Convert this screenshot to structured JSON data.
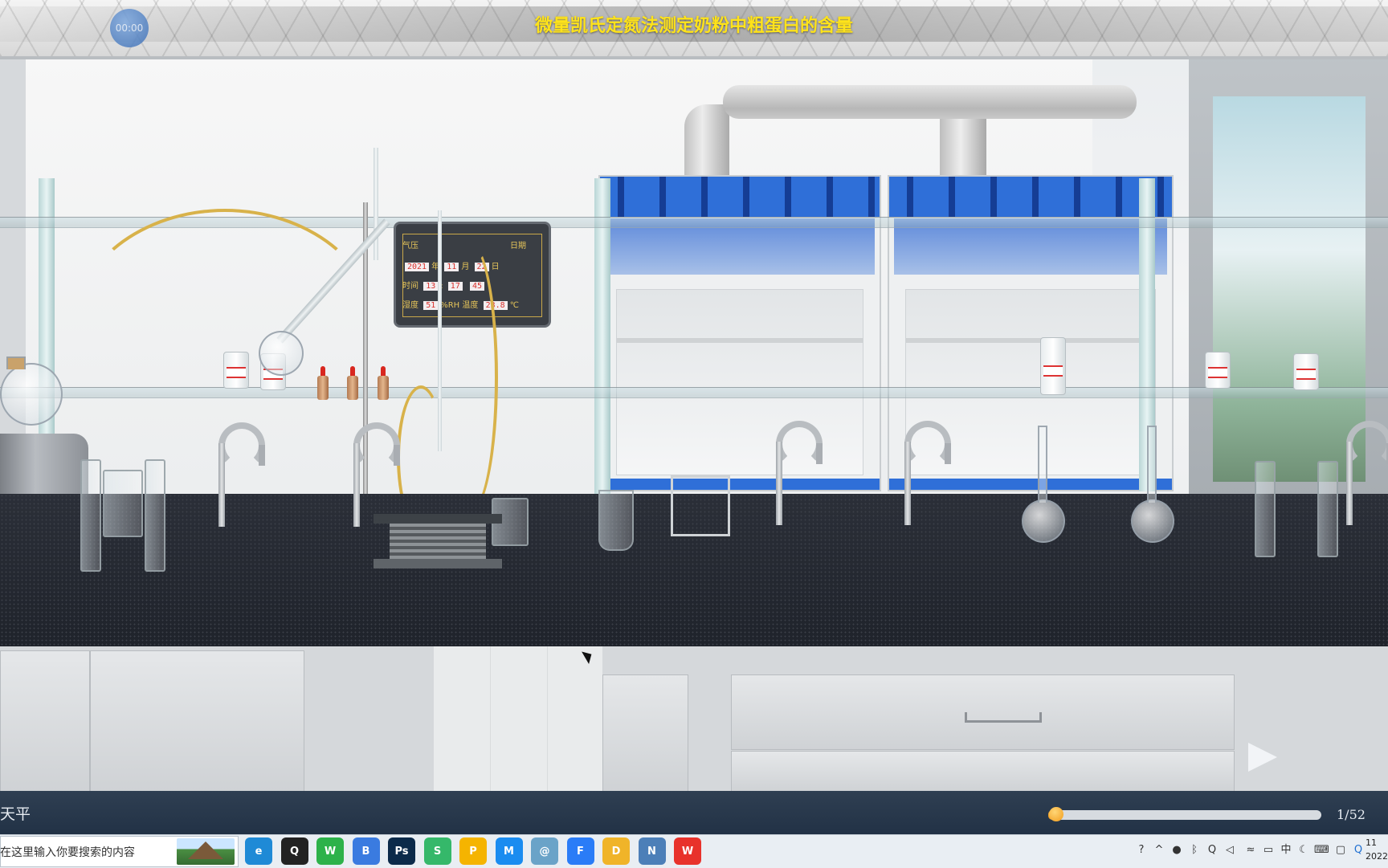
{
  "app": {
    "title": "微量凯氏定氮法测定奶粉中粗蛋白的含量",
    "timer": "00:00"
  },
  "monitor": {
    "pressure_label": "气压",
    "date_label": "日期",
    "year_value": "2021",
    "year_unit": "年",
    "month_value": "11",
    "month_unit": "月",
    "day_value": "22",
    "day_unit": "日",
    "time_label": "时间",
    "hour_value": "13",
    "time_sep": ":",
    "minute_value": "17",
    "second_value": "45",
    "humidity_label": "湿度",
    "humidity_value": "51",
    "humidity_unit": "%RH",
    "temp_label": "温度",
    "temp_value": "23.8",
    "temp_unit": "℃"
  },
  "controls": {
    "step_label": "天平",
    "page_count": "1/52",
    "progress": 0.03,
    "colors": {
      "bar": "#223246",
      "fill": "#f2a42a"
    }
  },
  "taskbar": {
    "search_text": "在这里输入你要搜索的内容",
    "apps": [
      {
        "name": "edge-icon",
        "glyph": "e",
        "color": "#1f8ad6"
      },
      {
        "name": "qq-icon",
        "glyph": "Q",
        "color": "#222222"
      },
      {
        "name": "wechat-icon",
        "glyph": "W",
        "color": "#2db24a"
      },
      {
        "name": "baidu-netdisk-icon",
        "glyph": "B",
        "color": "#3a7be0"
      },
      {
        "name": "photoshop-icon",
        "glyph": "Ps",
        "color": "#0b2a4a"
      },
      {
        "name": "sprite-icon",
        "glyph": "S",
        "color": "#35b86a"
      },
      {
        "name": "pdf-reader-icon",
        "glyph": "P",
        "color": "#f5b400"
      },
      {
        "name": "messenger-icon",
        "glyph": "M",
        "color": "#1a8cf0"
      },
      {
        "name": "app-swirl-icon",
        "glyph": "@",
        "color": "#6aa3c8"
      },
      {
        "name": "feishu-icon",
        "glyph": "F",
        "color": "#2a7cf7"
      },
      {
        "name": "file-explorer-icon",
        "glyph": "D",
        "color": "#f0b429"
      },
      {
        "name": "notepad-icon",
        "glyph": "N",
        "color": "#4c7fb8"
      },
      {
        "name": "wps-icon",
        "glyph": "W",
        "color": "#e8322b"
      }
    ],
    "tray": {
      "ime_label": "中",
      "clock_time": "11",
      "clock_date": "2022"
    }
  }
}
